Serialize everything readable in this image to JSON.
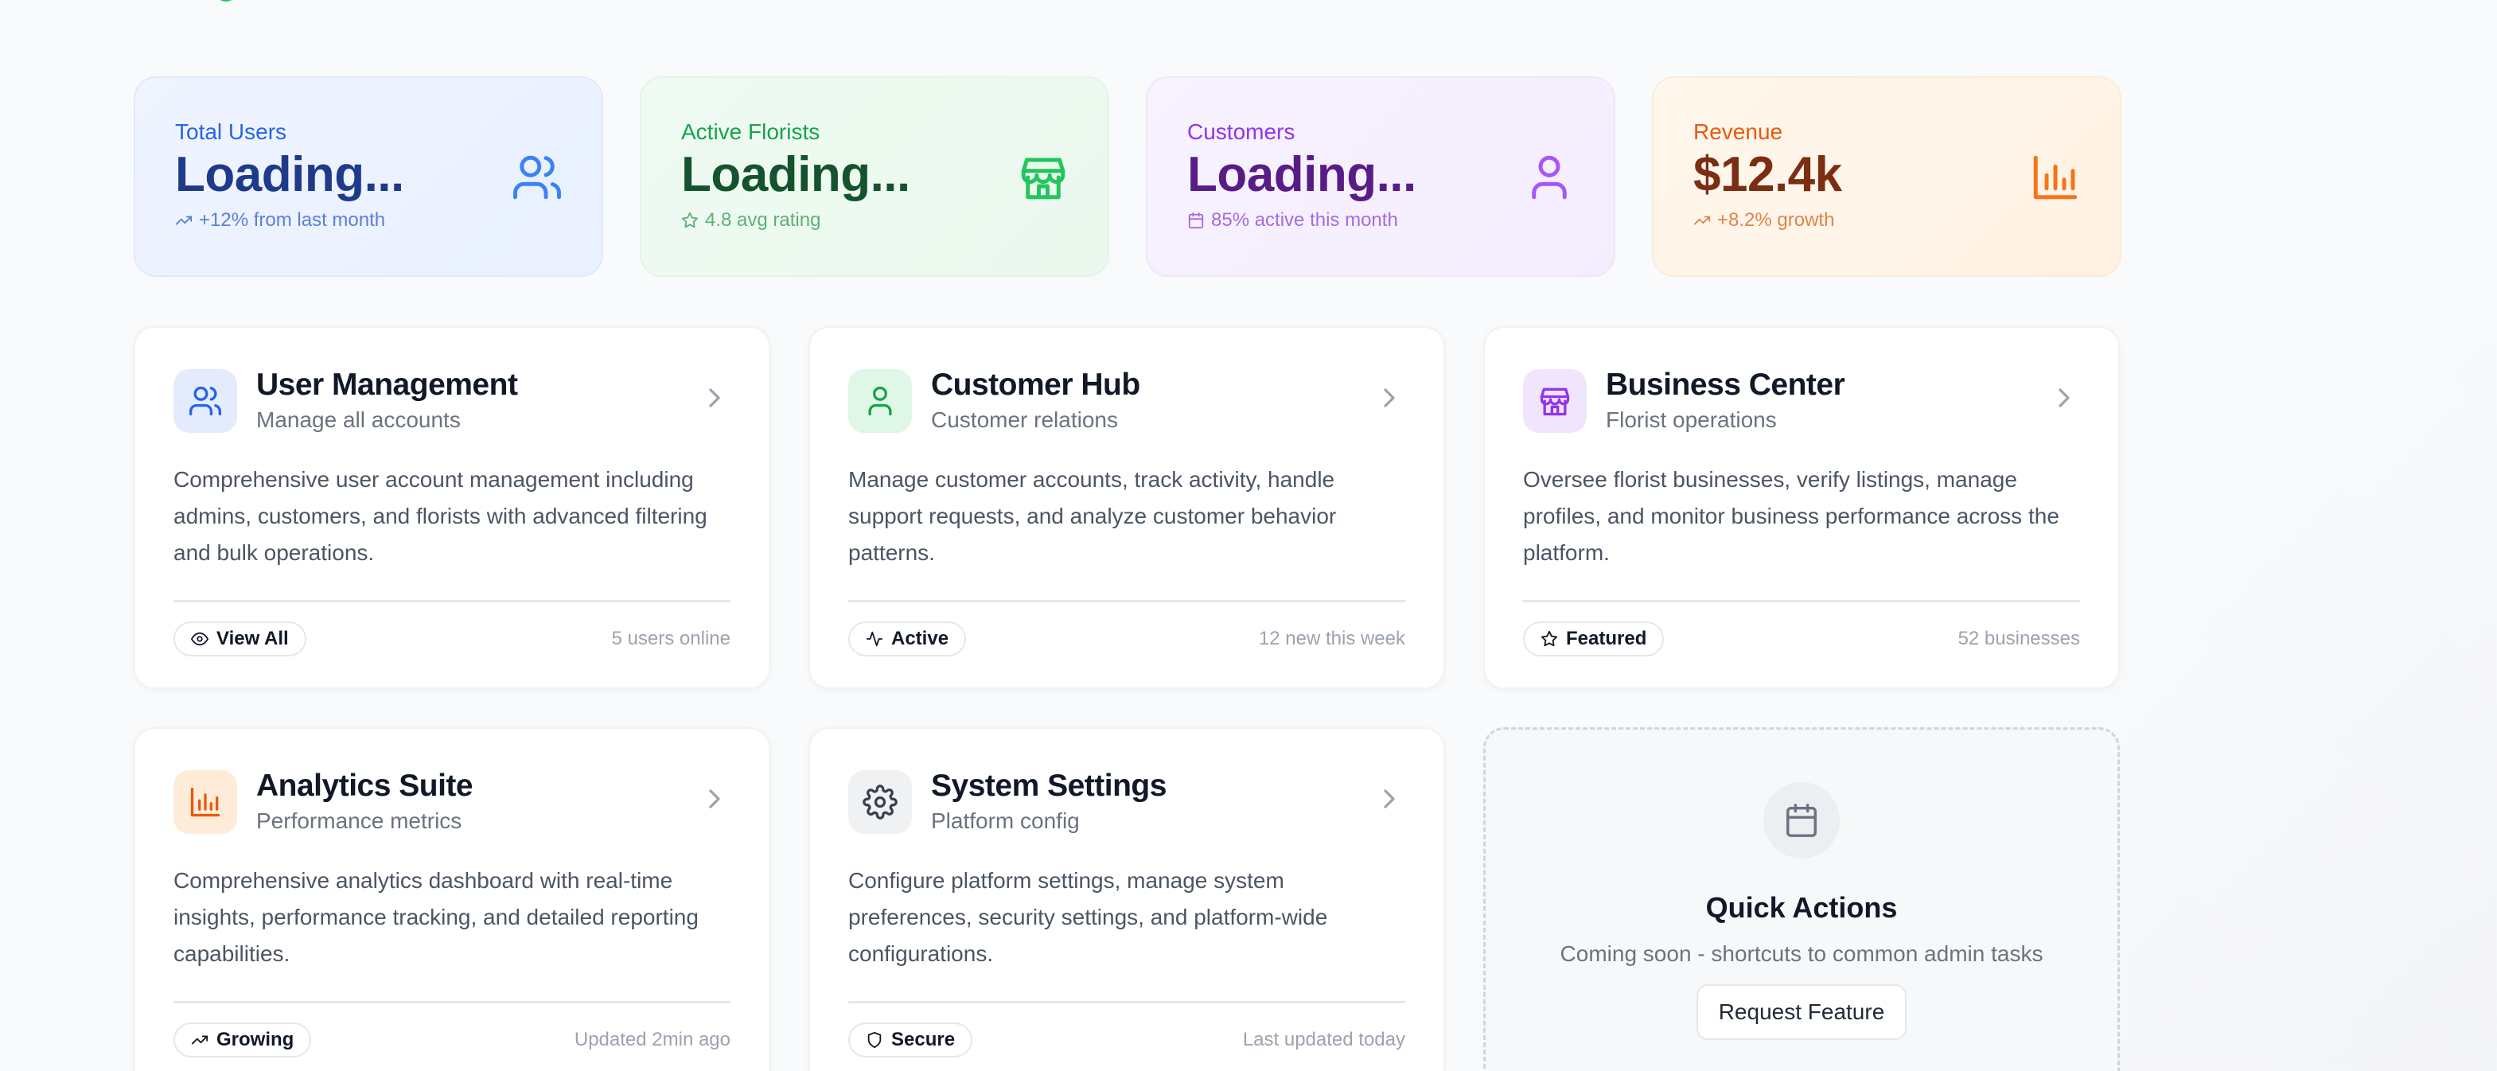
{
  "stats": [
    {
      "label": "Total Users",
      "value": "Loading...",
      "sub": "+12% from last month",
      "sub_icon": "trending-up-icon",
      "icon": "users-icon"
    },
    {
      "label": "Active Florists",
      "value": "Loading...",
      "sub": "4.8 avg rating",
      "sub_icon": "star-icon",
      "icon": "store-icon"
    },
    {
      "label": "Customers",
      "value": "Loading...",
      "sub": "85% active this month",
      "sub_icon": "calendar-icon",
      "icon": "user-icon"
    },
    {
      "label": "Revenue",
      "value": "$12.4k",
      "sub": "+8.2% growth",
      "sub_icon": "trending-up-icon",
      "icon": "bar-chart-icon"
    }
  ],
  "cards": [
    {
      "title": "User Management",
      "subtitle": "Manage all accounts",
      "description": "Comprehensive user account management including admins, customers, and florists with advanced filtering and bulk operations.",
      "badge": "View All",
      "badge_icon": "eye-icon",
      "note": "5 users online",
      "icon": "users-icon",
      "accent": "#2563eb"
    },
    {
      "title": "Customer Hub",
      "subtitle": "Customer relations",
      "description": "Manage customer accounts, track activity, handle support requests, and analyze customer behavior patterns.",
      "badge": "Active",
      "badge_icon": "activity-icon",
      "note": "12 new this week",
      "icon": "user-icon",
      "accent": "#16a34a"
    },
    {
      "title": "Business Center",
      "subtitle": "Florist operations",
      "description": "Oversee florist businesses, verify listings, manage profiles, and monitor business performance across the platform.",
      "badge": "Featured",
      "badge_icon": "star-icon",
      "note": "52 businesses",
      "icon": "store-icon",
      "accent": "#9333ea"
    },
    {
      "title": "Analytics Suite",
      "subtitle": "Performance metrics",
      "description": "Comprehensive analytics dashboard with real-time insights, performance tracking, and detailed reporting capabilities.",
      "badge": "Growing",
      "badge_icon": "trending-up-icon",
      "note": "Updated 2min ago",
      "icon": "bar-chart-icon",
      "accent": "#ea580c"
    },
    {
      "title": "System Settings",
      "subtitle": "Platform config",
      "description": "Configure platform settings, manage system preferences, security settings, and platform-wide configurations.",
      "badge": "Secure",
      "badge_icon": "shield-icon",
      "note": "Last updated today",
      "icon": "gear-icon",
      "accent": "#374151"
    }
  ],
  "quick_actions": {
    "title": "Quick Actions",
    "description": "Coming soon - shortcuts to common admin tasks",
    "button": "Request Feature",
    "icon": "calendar-icon"
  }
}
